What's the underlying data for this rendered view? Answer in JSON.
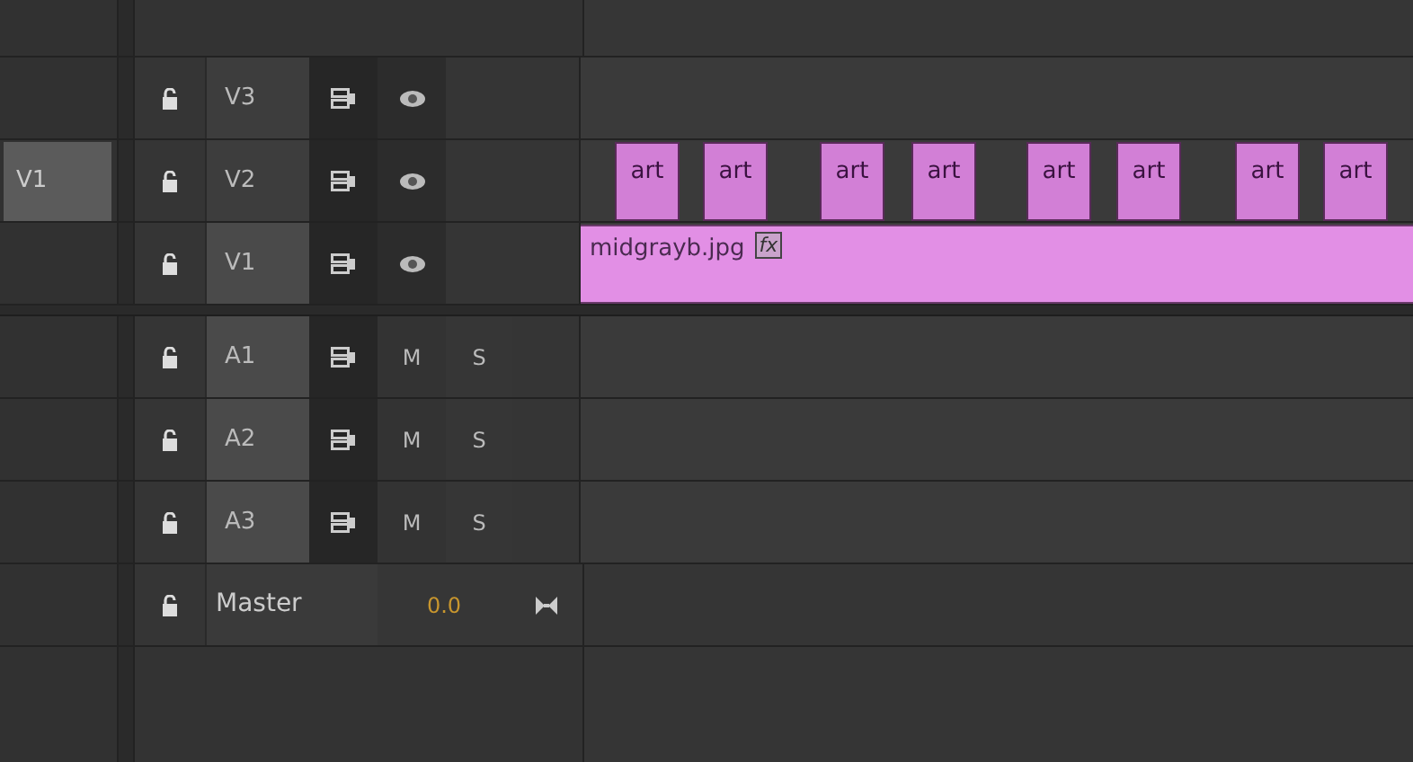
{
  "video_tracks": [
    {
      "name": "V3",
      "targeted": false
    },
    {
      "name": "V2",
      "targeted": false,
      "source_patch": "V1",
      "clips": [
        {
          "label": "art"
        },
        {
          "label": "art"
        },
        {
          "label": "art"
        },
        {
          "label": "art"
        },
        {
          "label": "art"
        },
        {
          "label": "art"
        },
        {
          "label": "art"
        },
        {
          "label": "art"
        }
      ]
    },
    {
      "name": "V1",
      "targeted": true,
      "clips": [
        {
          "label": "midgrayb.jpg",
          "fx": "fx"
        }
      ]
    }
  ],
  "audio_tracks": [
    {
      "name": "A1",
      "targeted": true,
      "mute": "M",
      "solo": "S"
    },
    {
      "name": "A2",
      "targeted": true,
      "mute": "M",
      "solo": "S"
    },
    {
      "name": "A3",
      "targeted": true,
      "mute": "M",
      "solo": "S"
    }
  ],
  "master": {
    "name": "Master",
    "volume": "0.0"
  }
}
